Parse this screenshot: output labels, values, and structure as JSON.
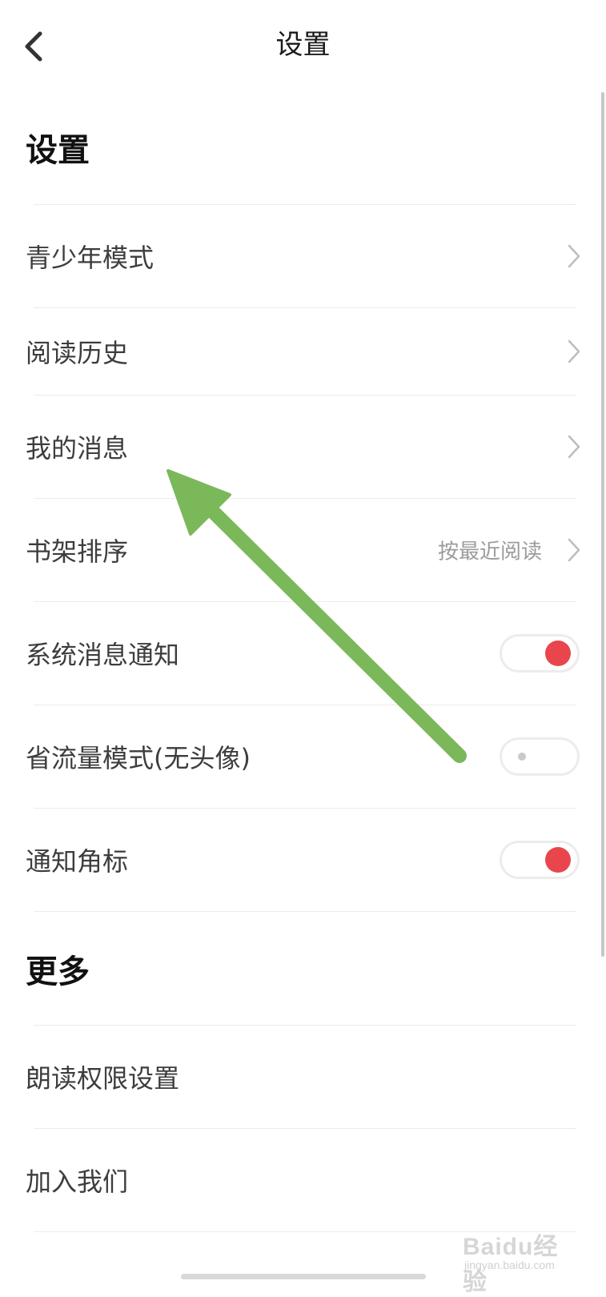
{
  "header": {
    "title": "设置",
    "back_icon": "chevron-left-icon"
  },
  "sections": [
    {
      "title": "设置",
      "items": [
        {
          "label": "青少年模式",
          "control": "chevron"
        },
        {
          "label": "阅读历史",
          "control": "chevron"
        },
        {
          "label": "我的消息",
          "control": "chevron"
        },
        {
          "label": "书架排序",
          "value": "按最近阅读",
          "control": "chevron"
        },
        {
          "label": "系统消息通知",
          "control": "toggle",
          "on": true
        },
        {
          "label": "省流量模式(无头像)",
          "control": "toggle",
          "on": false
        },
        {
          "label": "通知角标",
          "control": "toggle",
          "on": true
        }
      ]
    },
    {
      "title": "更多",
      "items": [
        {
          "label": "朗读权限设置",
          "control": "none"
        },
        {
          "label": "加入我们",
          "control": "none"
        }
      ]
    }
  ],
  "annotation": {
    "icon": "arrow-annotation-icon",
    "color": "#7ab85a"
  },
  "watermark": {
    "logo": "Baidu经验",
    "sub": "jingyan.baidu.com"
  },
  "colors": {
    "toggle_on": "#e8464c",
    "toggle_off_dot": "#c9c9c9",
    "divider": "#ececec"
  }
}
